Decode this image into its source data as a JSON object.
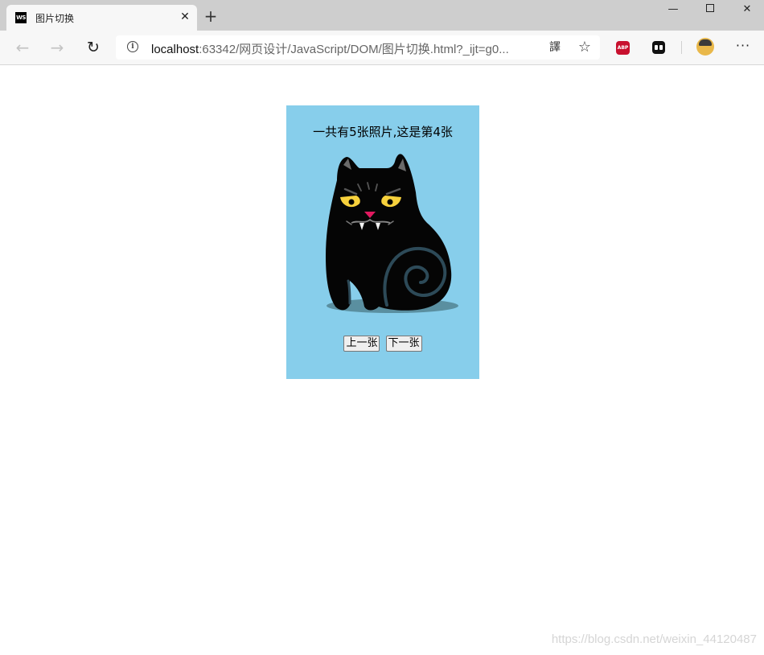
{
  "browser": {
    "tab": {
      "favicon_text": "WS",
      "title": "图片切换",
      "close_glyph": "✕"
    },
    "new_tab_glyph": "+",
    "window_controls": {
      "minimize": "—",
      "close": "✕"
    },
    "nav": {
      "back": "←",
      "forward": "→",
      "reload": "↻"
    },
    "address": {
      "host": "localhost",
      "path": ":63342/网页设计/JavaScript/DOM/图片切换.html?_ijt=g0..."
    },
    "icons": {
      "info": "i",
      "translate": "譯",
      "favorite": "☆",
      "abp_text": "ABP",
      "menu": "···"
    }
  },
  "page": {
    "caption": "一共有5张照片,这是第4张",
    "image_alt": "black-cat-illustration",
    "prev_button": "上一张",
    "next_button": "下一张",
    "background_color": "#87ceeb"
  },
  "watermark": "https://blog.csdn.net/weixin_44120487"
}
